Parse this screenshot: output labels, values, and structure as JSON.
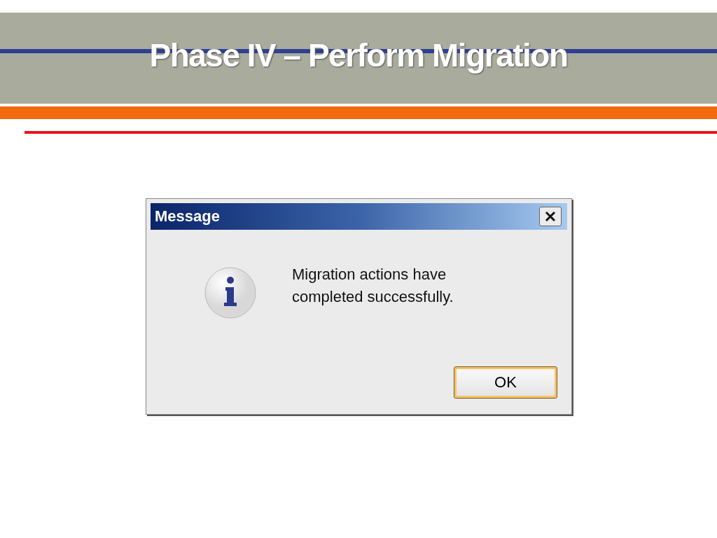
{
  "slide": {
    "title": "Phase IV – Perform Migration"
  },
  "dialog": {
    "title": "Message",
    "message": "Migration actions have completed successfully.",
    "buttons": [
      {
        "label": "OK",
        "selected": true
      }
    ]
  }
}
